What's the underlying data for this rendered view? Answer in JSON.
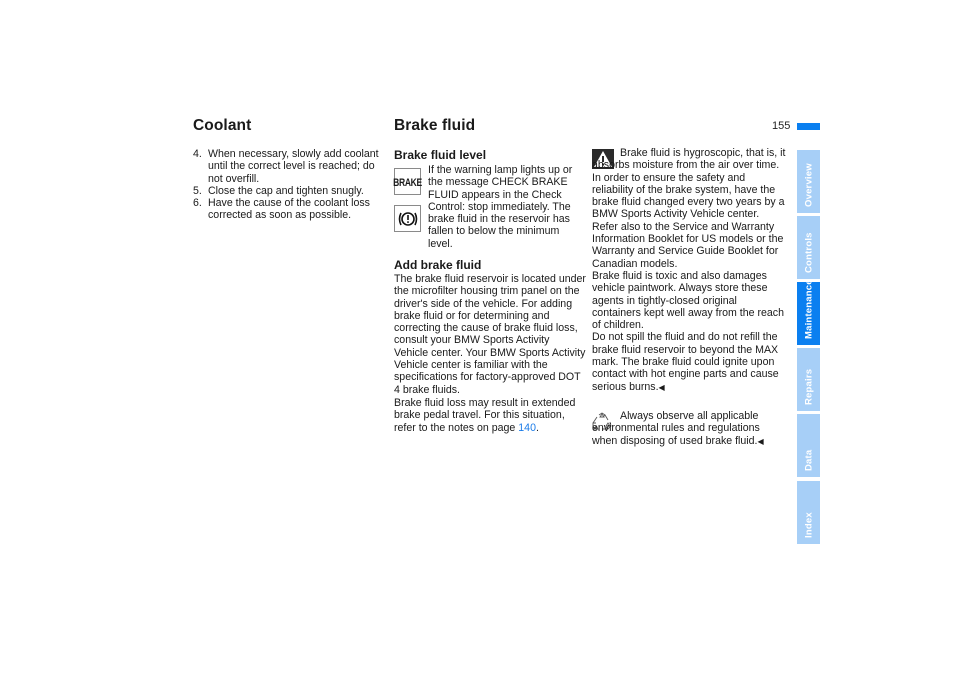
{
  "page": {
    "number": "155",
    "accent_color": "#0a7ff0",
    "tab_inactive_color": "#a7cff7"
  },
  "coolant": {
    "title": "Coolant",
    "steps": [
      {
        "num": "4.",
        "text": "When necessary, slowly add coolant until the correct level is reached; do not overfill."
      },
      {
        "num": "5.",
        "text": "Close the cap and tighten snugly."
      },
      {
        "num": "6.",
        "text": "Have the cause of the coolant loss corrected as soon as possible."
      }
    ]
  },
  "brake_fluid": {
    "title": "Brake fluid",
    "level": {
      "heading": "Brake fluid level",
      "icon_brake_label": "BRAKE",
      "icon_brake_name": "brake-warning-lamp-icon",
      "icon_circle_name": "brake-circle-exclamation-icon",
      "text": "If the warning lamp lights up or the message CHECK BRAKE FLUID appears in the Check Control: stop immediately. The brake fluid in the reservoir has fallen to below the minimum level."
    },
    "add": {
      "heading": "Add brake fluid",
      "para1": "The brake fluid reservoir is located under the microfilter housing trim panel on the driver's side of the vehicle. For adding brake fluid or for determining and correcting the cause of brake fluid loss, consult your BMW Sports Activity Vehicle center. Your BMW Sports Activity Vehicle center is familiar with the specifications for factory-approved DOT 4 brake fluids.",
      "para2_prefix": "Brake fluid loss may result in extended brake pedal travel. For this situation, refer to the notes on page ",
      "para2_link": "140",
      "para2_suffix": "."
    },
    "warning": {
      "icon": "warning-triangle-icon",
      "lead": "Brake fluid is hygroscopic, that is, it absorbs moisture from the air over time.",
      "p1": "In order to ensure the safety and reliability of the brake system, have the brake fluid changed every two years by a BMW Sports Activity Vehicle center. Refer also to the Service and Warranty Information Booklet for US models or the Warranty and Service Guide Booklet for Canadian models.",
      "p2": "Brake fluid is toxic and also damages vehicle paintwork. Always store these agents in tightly-closed original containers kept well away from the reach of children.",
      "p3": "Do not spill the fluid and do not refill the brake fluid reservoir to beyond the MAX mark. The brake fluid could ignite upon contact with hot engine parts and cause serious burns.",
      "end_mark": "◀"
    },
    "environment": {
      "icon": "recycle-icon",
      "text": "Always observe all applicable environmental rules and regulations when disposing of used brake fluid.",
      "end_mark": "◀"
    }
  },
  "tabs": [
    {
      "label": "Overview",
      "active": false
    },
    {
      "label": "Controls",
      "active": false
    },
    {
      "label": "Maintenance",
      "active": true
    },
    {
      "label": "Repairs",
      "active": false
    },
    {
      "label": "Data",
      "active": false
    },
    {
      "label": "Index",
      "active": false
    }
  ]
}
